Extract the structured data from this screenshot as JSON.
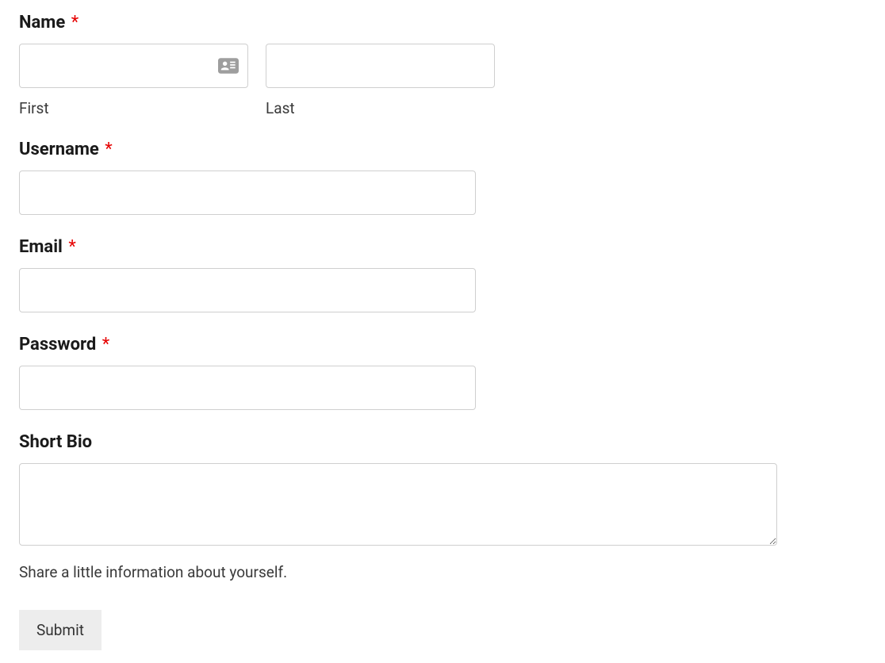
{
  "form": {
    "name": {
      "label": "Name",
      "required_mark": "*",
      "first_sub": "First",
      "last_sub": "Last",
      "first_value": "",
      "last_value": ""
    },
    "username": {
      "label": "Username",
      "required_mark": "*",
      "value": ""
    },
    "email": {
      "label": "Email",
      "required_mark": "*",
      "value": ""
    },
    "password": {
      "label": "Password",
      "required_mark": "*",
      "value": ""
    },
    "bio": {
      "label": "Short Bio",
      "value": "",
      "help": "Share a little information about yourself."
    },
    "submit_label": "Submit"
  }
}
